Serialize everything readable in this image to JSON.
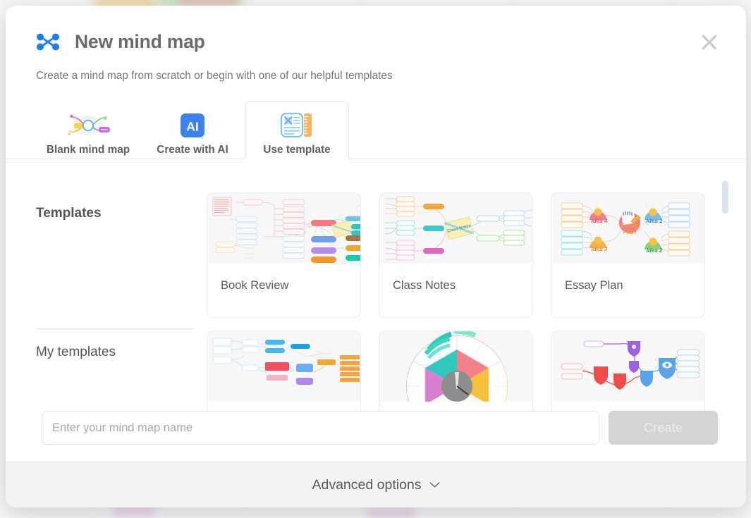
{
  "modal": {
    "icon": "mindmap-icon",
    "title": "New mind map",
    "subtitle": "Create a mind map from scratch or begin with one of our helpful templates",
    "close_icon": "close-icon"
  },
  "tabs": [
    {
      "label": "Blank mind map",
      "icon": "mindmap-sketch-icon",
      "active": false
    },
    {
      "label": "Create with AI",
      "icon": "ai-badge-icon",
      "active": false
    },
    {
      "label": "Use template",
      "icon": "template-ruler-icon",
      "active": true
    }
  ],
  "sections": {
    "templates_heading": "Templates",
    "my_templates_heading": "My templates"
  },
  "template_cards": [
    {
      "name": "Book Review",
      "thumb": "book-review-map"
    },
    {
      "name": "Class Notes",
      "thumb": "class-notes-map"
    },
    {
      "name": "Essay Plan",
      "thumb": "essay-plan-map"
    }
  ],
  "my_template_cards": [
    {
      "name": "",
      "thumb": "orange-blue-map"
    },
    {
      "name": "",
      "thumb": "radial-wheel-map"
    },
    {
      "name": "",
      "thumb": "shield-network-map"
    }
  ],
  "name_field": {
    "placeholder": "Enter your mind map name",
    "value": ""
  },
  "create_button": {
    "label": "Create",
    "enabled": false
  },
  "footer": {
    "advanced_options_label": "Advanced options",
    "chevron_icon": "chevron-down-icon"
  },
  "colors": {
    "accent_blue": "#2f80ed",
    "title_gray": "#6a6a6a",
    "body_gray": "#767676",
    "disabled_button": "#d4d4d4",
    "footer_bg": "#f3f3f3",
    "scrollbar_thumb": "#d9e4ec",
    "card_border": "#e6eef3"
  }
}
